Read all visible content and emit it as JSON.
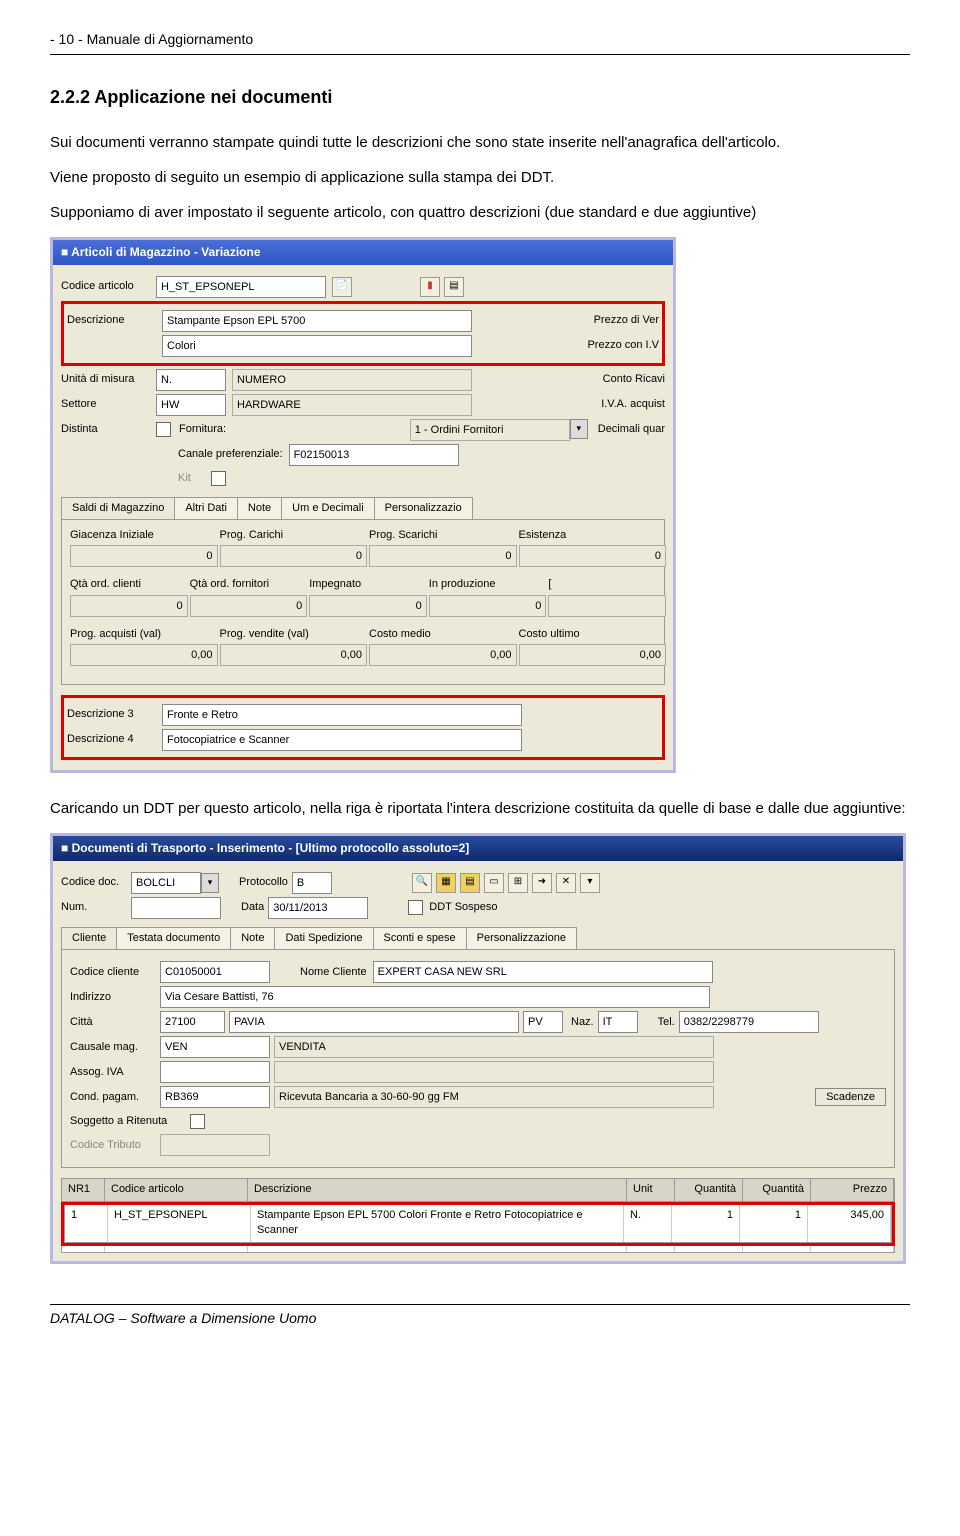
{
  "header": {
    "page": "- 10 -  Manuale di Aggiornamento"
  },
  "section": {
    "title": "2.2.2  Applicazione nei documenti",
    "p1": "Sui documenti verranno stampate quindi tutte le descrizioni che sono state inserite nell'anagrafica dell'articolo.",
    "p2": "Viene proposto di seguito un esempio di applicazione sulla stampa dei DDT.",
    "p3": "Supponiamo di aver impostato il seguente articolo, con quattro descrizioni (due standard e due aggiuntive)",
    "p4": "Caricando un DDT per questo articolo, nella riga è riportata l'intera descrizione costituita da quelle di base e dalle due aggiuntive:"
  },
  "win1": {
    "title": "Articoli di Magazzino - Variazione",
    "labels": {
      "codice": "Codice articolo",
      "descrizione": "Descrizione",
      "unita": "Unità di misura",
      "settore": "Settore",
      "distinta": "Distinta",
      "fornitura": "Fornitura:",
      "canale": "Canale preferenziale:",
      "kit": "Kit",
      "prezzo_ven": "Prezzo di Ver",
      "prezzo_iva": "Prezzo con I.V",
      "conto_ricavi": "Conto Ricavi",
      "iva_acq": "I.V.A. acquist",
      "dec_quar": "Decimali quar",
      "d3": "Descrizione 3",
      "d4": "Descrizione 4"
    },
    "vals": {
      "codice": "H_ST_EPSONEPL",
      "desc1": "Stampante Epson EPL 5700",
      "desc2": "Colori",
      "unita_short": "N.",
      "unita_long": "NUMERO",
      "settore_short": "HW",
      "settore_long": "HARDWARE",
      "fornitura": "1 - Ordini Fornitori",
      "canale": "F02150013",
      "d3": "Fronte e Retro",
      "d4": "Fotocopiatrice e Scanner"
    },
    "tabs": {
      "t1": "Saldi di Magazzino",
      "t2": "Altri Dati",
      "t3": "Note",
      "t4": "Um e Decimali",
      "t5": "Personalizzazio"
    },
    "saldi": {
      "giac": "Giacenza Iniziale",
      "prog_car": "Prog. Carichi",
      "prog_scar": "Prog. Scarichi",
      "esist": "Esistenza",
      "qta_cli": "Qtà ord. clienti",
      "qta_for": "Qtà ord. fornitori",
      "impeg": "Impegnato",
      "inprod": "In produzione",
      "prog_acq": "Prog. acquisti (val)",
      "prog_ven": "Prog. vendite (val)",
      "costo_medio": "Costo medio",
      "costo_ult": "Costo ultimo",
      "v0": "0",
      "v000": "0,00"
    }
  },
  "win2": {
    "title": "Documenti di Trasporto - Inserimento - [Ultimo protocollo assoluto=2]",
    "labels": {
      "codice_doc": "Codice doc.",
      "protocollo": "Protocollo",
      "num": "Num.",
      "data": "Data",
      "ddt_sospeso": "DDT Sospeso",
      "codice_cliente": "Codice cliente",
      "nome_cliente": "Nome Cliente",
      "indirizzo": "Indirizzo",
      "citta": "Città",
      "naz": "Naz.",
      "tel": "Tel.",
      "causale": "Causale mag.",
      "assog": "Assog. IVA",
      "cond_pag": "Cond. pagam.",
      "soggetto": "Soggetto a Ritenuta",
      "cod_tributo": "Codice Tributo",
      "scadenze": "Scadenze"
    },
    "tabs": {
      "t1": "Cliente",
      "t2": "Testata documento",
      "t3": "Note",
      "t4": "Dati Spedizione",
      "t5": "Sconti e spese",
      "t6": "Personalizzazione"
    },
    "vals": {
      "codice_doc": "BOLCLI",
      "protocollo": "B",
      "data": "30/11/2013",
      "codice_cliente": "C01050001",
      "nome_cliente": "EXPERT CASA NEW SRL",
      "indirizzo": "Via Cesare Battisti, 76",
      "citta_cap": "27100",
      "citta": "PAVIA",
      "prov": "PV",
      "naz": "IT",
      "tel": "0382/2298779",
      "causale_short": "VEN",
      "causale_long": "VENDITA",
      "cond_pag_short": "RB369",
      "cond_pag_long": "Ricevuta Bancaria a 30-60-90 gg FM"
    },
    "table": {
      "hdr": {
        "nr": "NR1",
        "code": "Codice articolo",
        "desc": "Descrizione",
        "unit": "Unit",
        "qty1": "Quantità",
        "qty2": "Quantità",
        "price": "Prezzo"
      },
      "row1": {
        "nr": "1",
        "code": "H_ST_EPSONEPL",
        "desc": "Stampante Epson EPL 5700 Colori Fronte e Retro Fotocopiatrice e Scanner",
        "unit": "N.",
        "qty1": "1",
        "qty2": "1",
        "price": "345,00"
      }
    }
  },
  "footer": "DATALOG – Software a Dimensione Uomo"
}
